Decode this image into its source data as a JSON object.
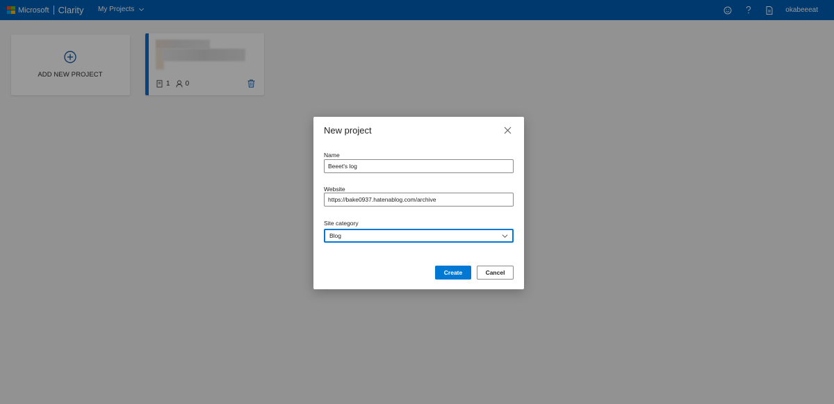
{
  "header": {
    "brand": "Microsoft",
    "app_name": "Clarity",
    "projects_menu_label": "My Projects",
    "user_name": "okabeeeat",
    "bar_color": "#005fb8",
    "icons": [
      "smiley-icon",
      "help-icon",
      "document-icon"
    ]
  },
  "cards": {
    "add_project_label": "ADD NEW PROJECT",
    "project": {
      "recordings_count": "1",
      "users_count": "0",
      "accent_color": "#0a6fd6"
    }
  },
  "modal": {
    "title": "New project",
    "name_label": "Name",
    "name_value": "Beeet's log",
    "website_label": "Website",
    "website_value": "https://bake0937.hatenablog.com/archive",
    "category_label": "Site category",
    "category_value": "Blog",
    "create_label": "Create",
    "cancel_label": "Cancel",
    "primary_color": "#0078d4"
  }
}
